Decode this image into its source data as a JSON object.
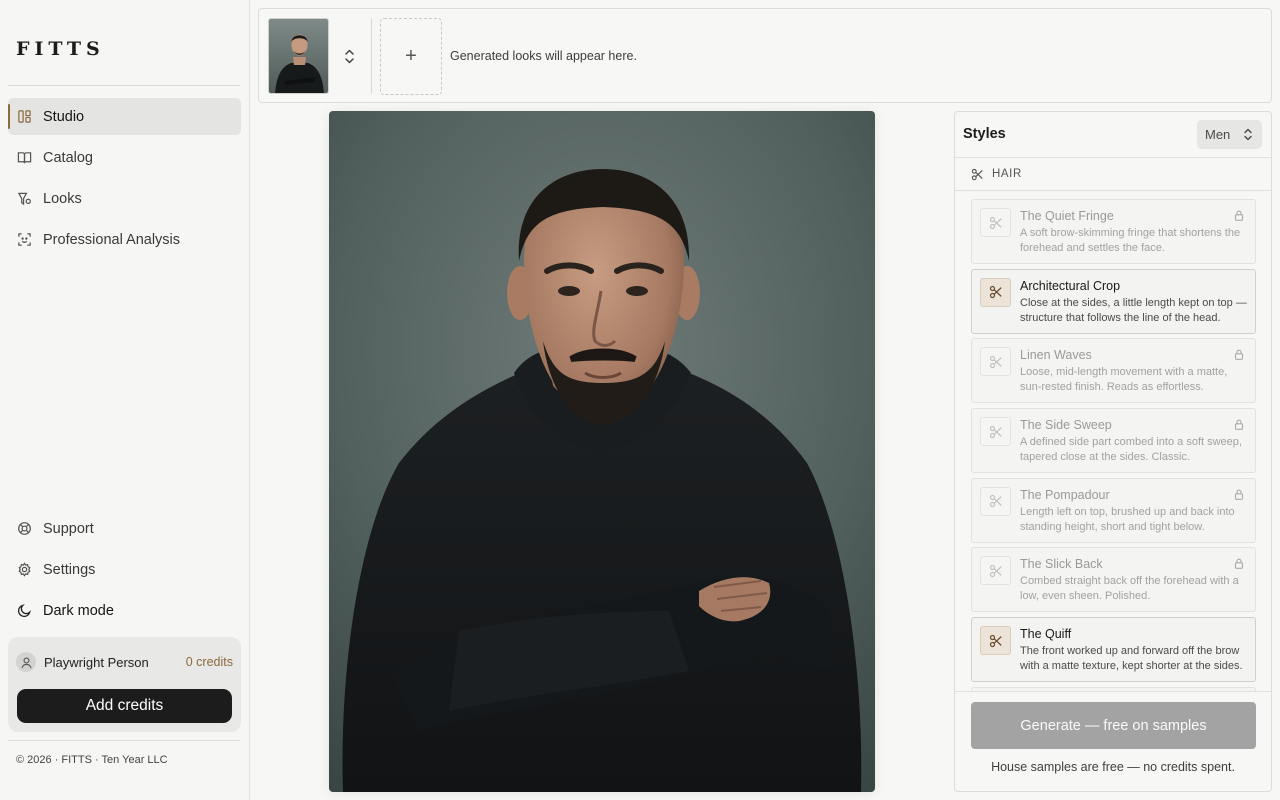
{
  "sidebar": {
    "brand": "FITTS",
    "nav": [
      {
        "label": "Studio",
        "icon": "studio-icon",
        "active": true
      },
      {
        "label": "Catalog",
        "icon": "book-icon",
        "active": false
      },
      {
        "label": "Looks",
        "icon": "hanger-icon",
        "active": false
      },
      {
        "label": "Professional Analysis",
        "icon": "scan-icon",
        "active": false
      }
    ],
    "bottom_nav": [
      {
        "label": "Support",
        "icon": "lifebuoy-icon"
      },
      {
        "label": "Settings",
        "icon": "gear-icon"
      },
      {
        "label": "Dark mode",
        "icon": "moon-icon"
      }
    ],
    "account": {
      "name": "Playwright Person",
      "credits": "0 credits",
      "add_credits_label": "Add credits"
    },
    "copyright": "© 2026 · FITTS · Ten Year LLC"
  },
  "topbar": {
    "hint": "Generated looks will appear here.",
    "add_label": "+"
  },
  "panel": {
    "title": "Styles",
    "gender": "Men",
    "section": "HAIR",
    "styles": [
      {
        "title": "The Quiet Fringe",
        "desc": "A soft brow-skimming fringe that shortens the forehead and settles the face.",
        "locked": true
      },
      {
        "title": "Architectural Crop",
        "desc": "Close at the sides, a little length kept on top — structure that follows the line of the head.",
        "locked": false
      },
      {
        "title": "Linen Waves",
        "desc": "Loose, mid-length movement with a matte, sun-rested finish. Reads as effortless.",
        "locked": true
      },
      {
        "title": "The Side Sweep",
        "desc": "A defined side part combed into a soft sweep, tapered close at the sides. Classic.",
        "locked": true
      },
      {
        "title": "The Pompadour",
        "desc": "Length left on top, brushed up and back into standing height, short and tight below.",
        "locked": true
      },
      {
        "title": "The Slick Back",
        "desc": "Combed straight back off the forehead with a low, even sheen. Polished.",
        "locked": true
      },
      {
        "title": "The Quiff",
        "desc": "The front worked up and forward off the brow with a matte texture, kept shorter at the sides.",
        "locked": false
      },
      {
        "title": "",
        "desc": "",
        "locked": true
      }
    ],
    "generate_label": "Generate — free on samples",
    "note": "House samples are free — no credits spent."
  },
  "colors": {
    "accent": "#8a6a3f",
    "primary_button": "#1c1c1c",
    "disabled_button": "#a3a3a3"
  }
}
